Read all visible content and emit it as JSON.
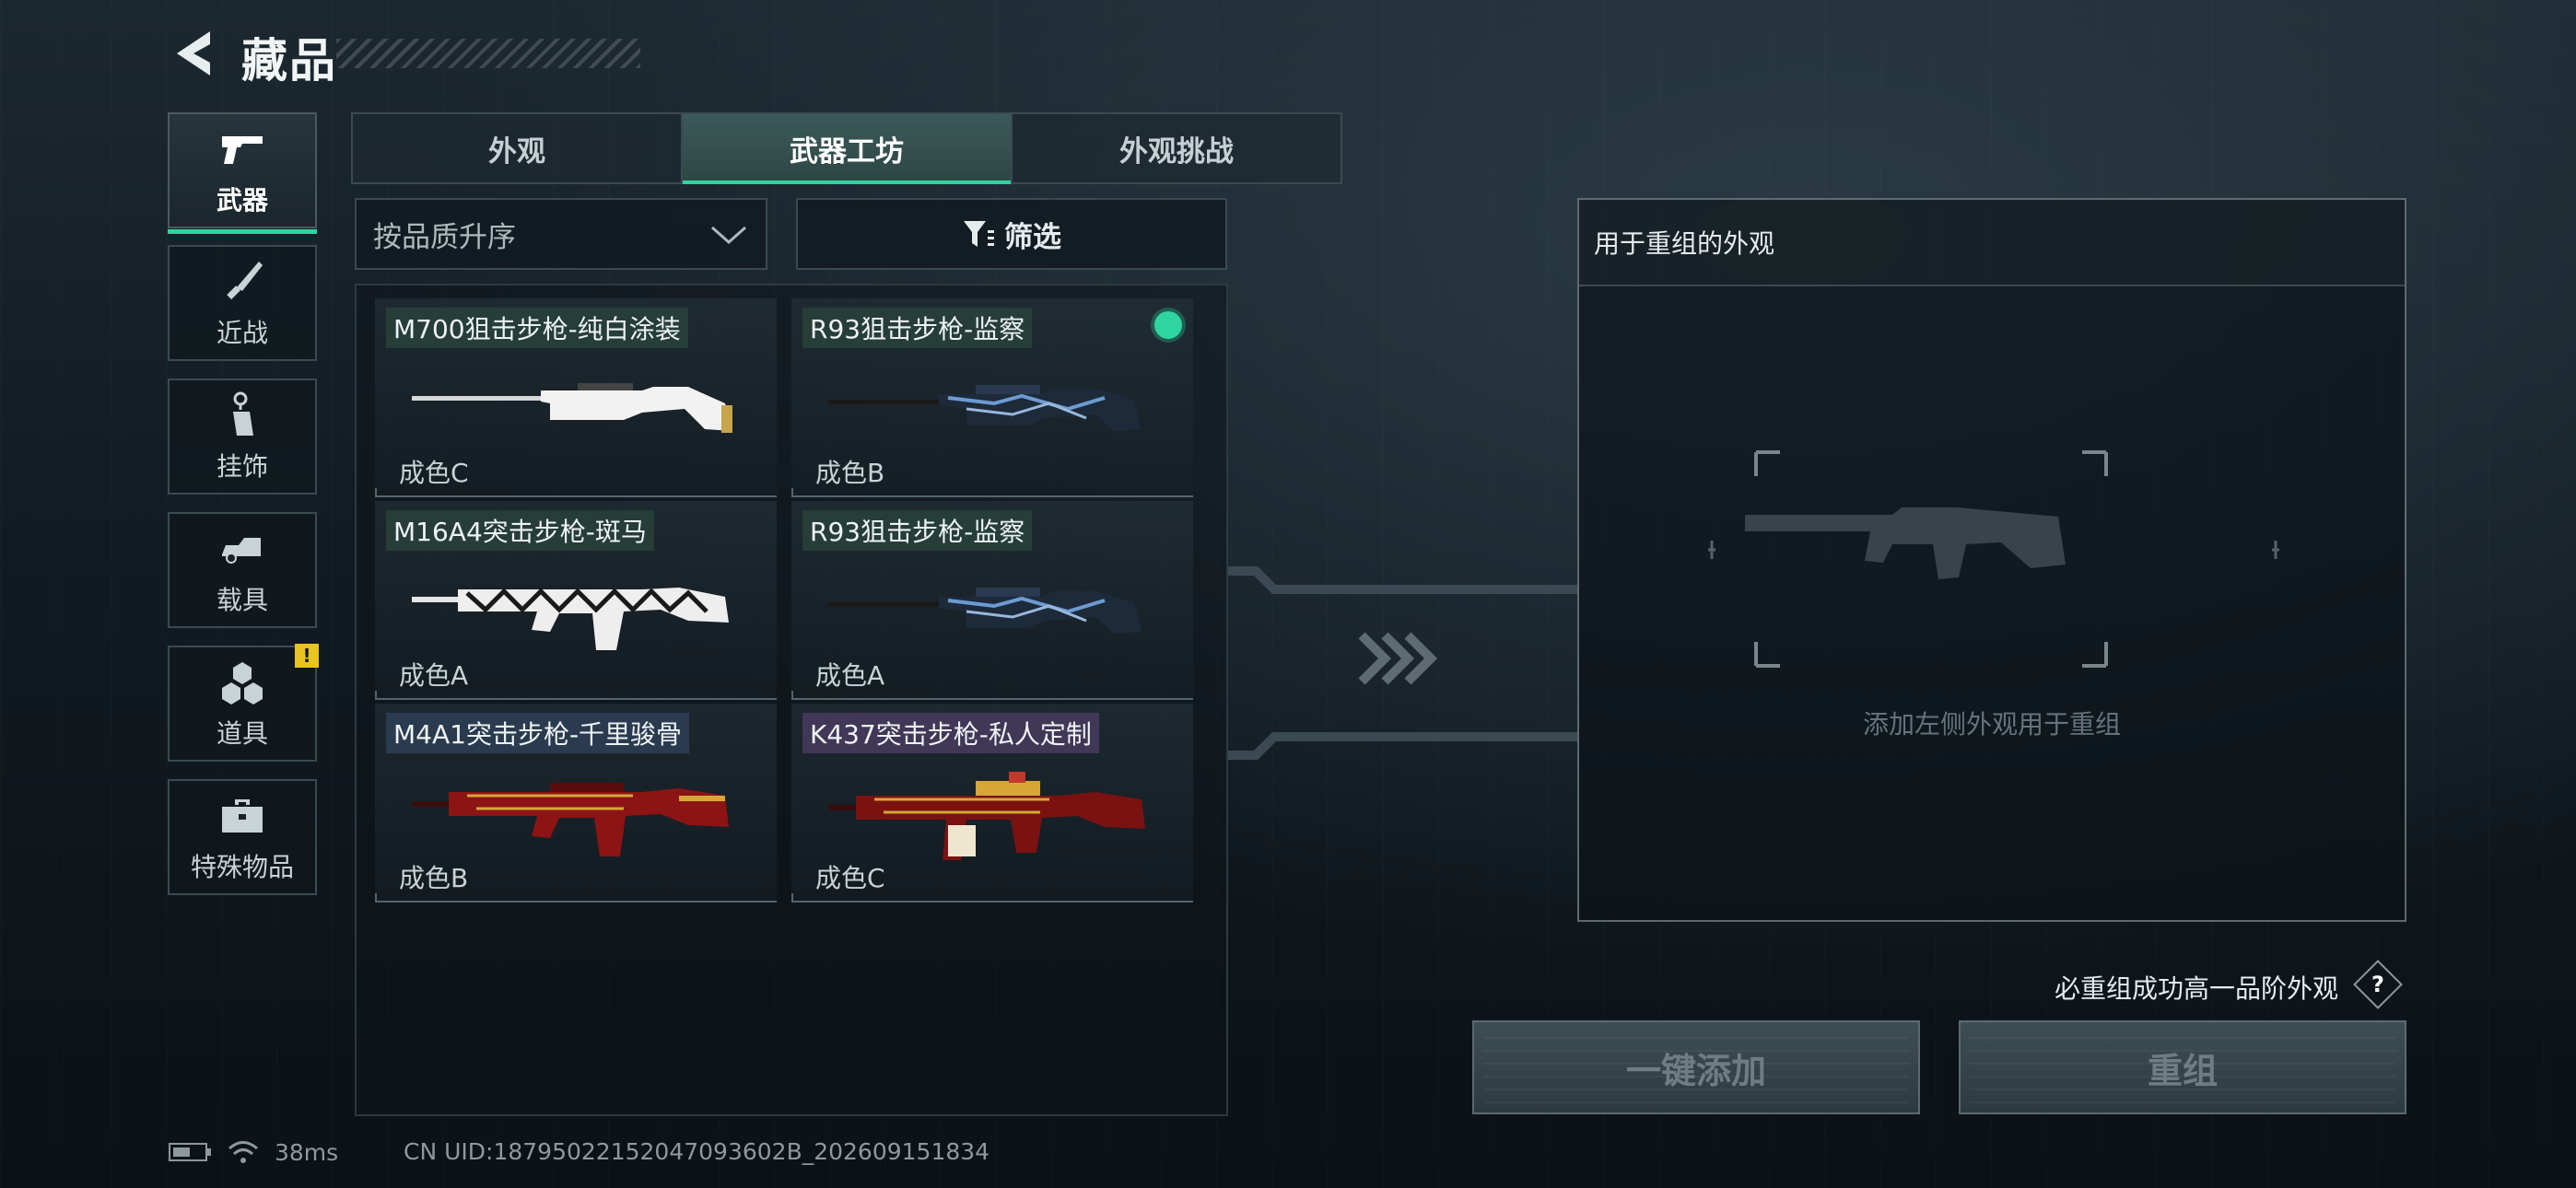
{
  "header": {
    "title": "藏品"
  },
  "sidebar": {
    "items": [
      {
        "label": "武器",
        "icon": "pistol-icon",
        "active": true
      },
      {
        "label": "近战",
        "icon": "knife-icon"
      },
      {
        "label": "挂饰",
        "icon": "charm-icon"
      },
      {
        "label": "载具",
        "icon": "vehicle-icon"
      },
      {
        "label": "道具",
        "icon": "items-icon",
        "badge": "!"
      },
      {
        "label": "特殊物品",
        "icon": "toolbox-icon"
      }
    ]
  },
  "tabs": [
    {
      "label": "外观"
    },
    {
      "label": "武器工坊",
      "active": true
    },
    {
      "label": "外观挑战"
    }
  ],
  "sort": {
    "label": "按品质升序"
  },
  "filter": {
    "label": "筛选"
  },
  "cards": [
    {
      "name": "M700狙击步枪-纯白涂装",
      "condition": "成色C",
      "skin": "white"
    },
    {
      "name": "R93狙击步枪-监察",
      "condition": "成色B",
      "skin": "blue",
      "selected": true
    },
    {
      "name": "M16A4突击步枪-斑马",
      "condition": "成色A",
      "skin": "zebra"
    },
    {
      "name": "R93狙击步枪-监察",
      "condition": "成色A",
      "skin": "blue"
    },
    {
      "name": "M4A1突击步枪-千里骏骨",
      "condition": "成色B",
      "skin": "red"
    },
    {
      "name": "K437突击步枪-私人定制",
      "condition": "成色C",
      "skin": "redgold"
    }
  ],
  "recombine_panel": {
    "header": "用于重组的外观",
    "hint": "添加左侧外观用于重组"
  },
  "guarantee": "必重组成功高一品阶外观",
  "help": "?",
  "buttons": {
    "add_all": "一键添加",
    "recombine": "重组"
  },
  "status": {
    "ping": "38ms",
    "uid": "CN UID:18795022152047093602B_202609151834"
  },
  "colors": {
    "accent": "#2fd4a0",
    "badge": "#e8c41f"
  }
}
